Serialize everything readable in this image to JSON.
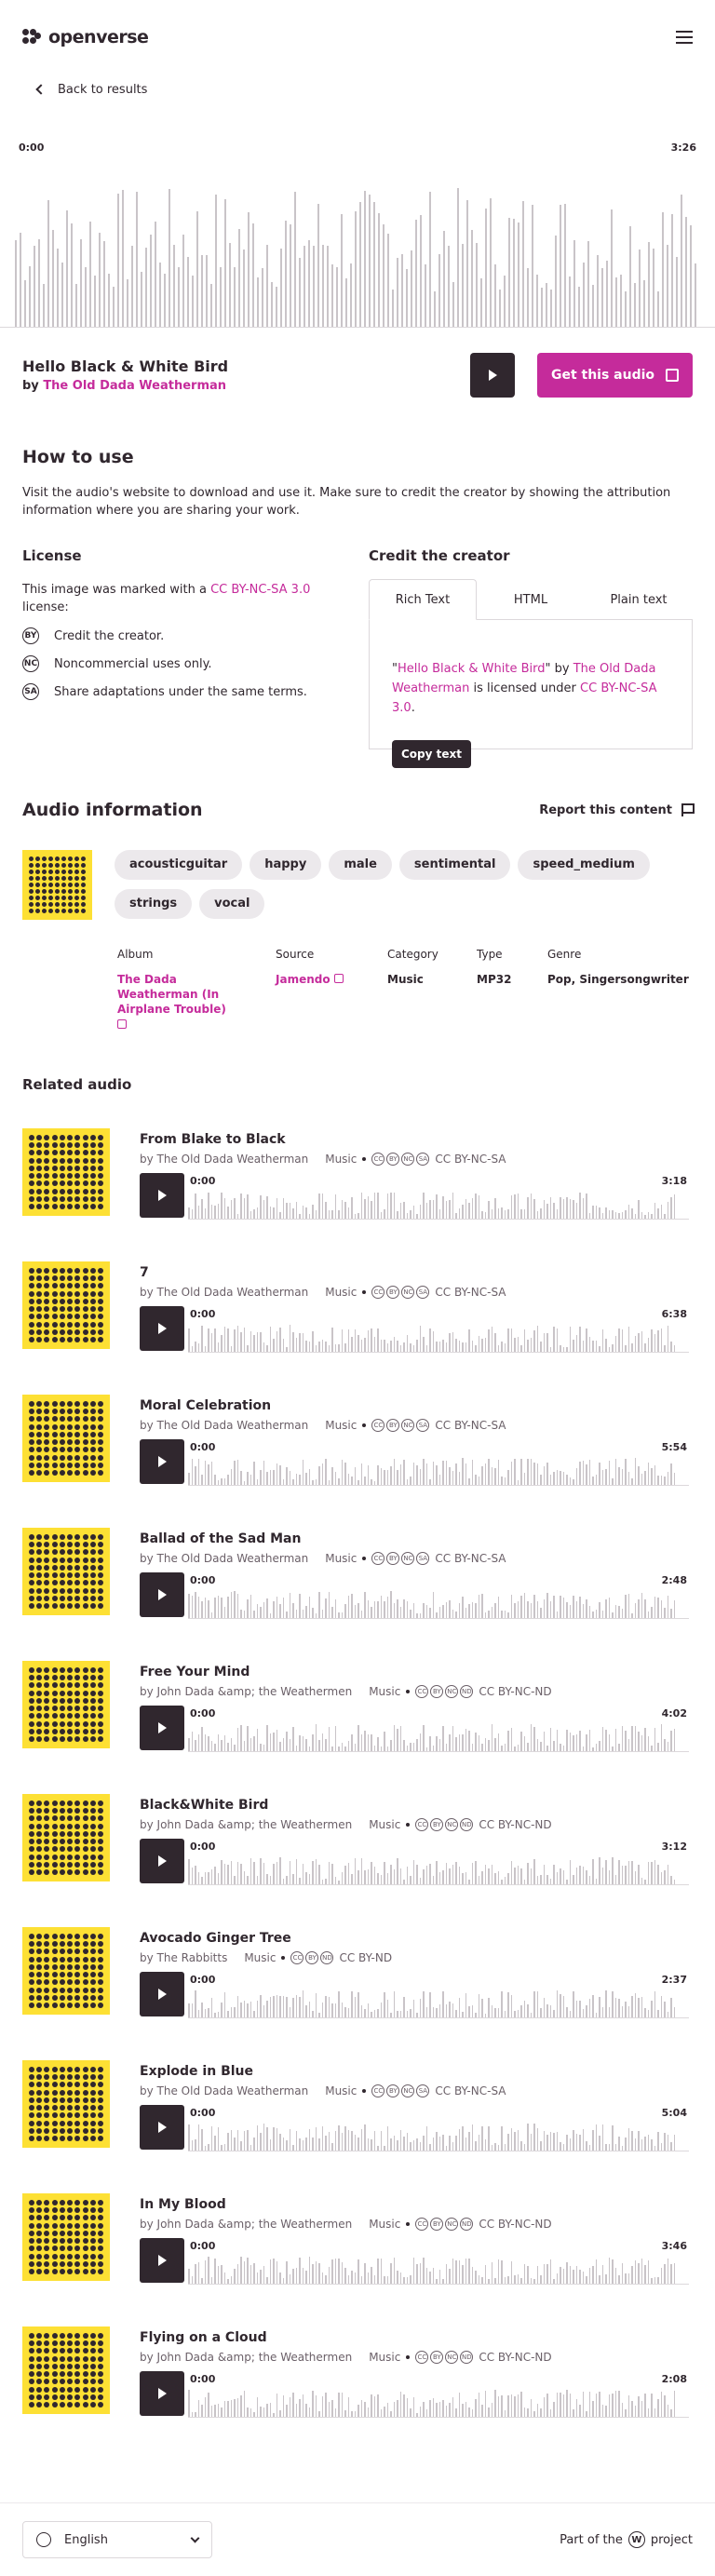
{
  "header": {
    "logo_text": "openverse"
  },
  "back_link": "Back to results",
  "player": {
    "start_time": "0:00",
    "end_time": "3:26"
  },
  "audio": {
    "title": "Hello Black & White Bird",
    "by_prefix": "by",
    "creator": "The Old Dada Weatherman",
    "get_button": "Get this audio"
  },
  "how_to_use": {
    "heading": "How to use",
    "text": "Visit the audio's website to download and use it. Make sure to credit the creator by showing the attribution information where you are sharing your work."
  },
  "license": {
    "heading": "License",
    "text_prefix": "This image was marked with a",
    "license_name": "CC BY-NC-SA 3.0",
    "text_suffix": "license:",
    "items": [
      {
        "icon": "BY",
        "text": "Credit the creator."
      },
      {
        "icon": "NC",
        "text": "Noncommercial uses only."
      },
      {
        "icon": "SA",
        "text": "Share adaptations under the same terms."
      }
    ]
  },
  "credit": {
    "heading": "Credit the creator",
    "tabs": [
      "Rich Text",
      "HTML",
      "Plain text"
    ],
    "quote_open": "\"",
    "work_title": "Hello Black & White Bird",
    "quote_by": "\" by",
    "creator": "The Old Dada Weatherman",
    "licensed_under": "is licensed under",
    "license": "CC BY-NC-SA 3.0",
    "period": ".",
    "copy_button": "Copy text"
  },
  "audio_info": {
    "heading": "Audio information",
    "report": "Report this content",
    "tags": [
      "acousticguitar",
      "happy",
      "male",
      "sentimental",
      "speed_medium",
      "strings",
      "vocal"
    ],
    "meta": {
      "album_label": "Album",
      "album_value": "The Dada Weatherman (In Airplane Trouble)",
      "source_label": "Source",
      "source_value": "Jamendo",
      "category_label": "Category",
      "category_value": "Music",
      "type_label": "Type",
      "type_value": "MP32",
      "genre_label": "Genre",
      "genre_value": "Pop, Singersongwriter"
    }
  },
  "related": {
    "heading": "Related audio",
    "items": [
      {
        "title": "From Blake to Black",
        "by": "by The Old Dada Weatherman",
        "category": "Music",
        "license": "CC BY-NC-SA",
        "start": "0:00",
        "duration": "3:18"
      },
      {
        "title": "7",
        "by": "by The Old Dada Weatherman",
        "category": "Music",
        "license": "CC BY-NC-SA",
        "start": "0:00",
        "duration": "6:38"
      },
      {
        "title": "Moral Celebration",
        "by": "by The Old Dada Weatherman",
        "category": "Music",
        "license": "CC BY-NC-SA",
        "start": "0:00",
        "duration": "5:54"
      },
      {
        "title": "Ballad of the Sad Man",
        "by": "by The Old Dada Weatherman",
        "category": "Music",
        "license": "CC BY-NC-SA",
        "start": "0:00",
        "duration": "2:48"
      },
      {
        "title": "Free Your Mind",
        "by": "by John Dada &amp; the Weathermen",
        "category": "Music",
        "license": "CC BY-NC-ND",
        "start": "0:00",
        "duration": "4:02"
      },
      {
        "title": "Black&White Bird",
        "by": "by John Dada &amp; the Weathermen",
        "category": "Music",
        "license": "CC BY-NC-ND",
        "start": "0:00",
        "duration": "3:12"
      },
      {
        "title": "Avocado Ginger Tree",
        "by": "by The Rabbitts",
        "category": "Music",
        "license": "CC BY-ND",
        "start": "0:00",
        "duration": "2:37"
      },
      {
        "title": "Explode in Blue",
        "by": "by The Old Dada Weatherman",
        "category": "Music",
        "license": "CC BY-NC-SA",
        "start": "0:00",
        "duration": "5:04"
      },
      {
        "title": "In My Blood",
        "by": "by John Dada &amp; the Weathermen",
        "category": "Music",
        "license": "CC BY-NC-ND",
        "start": "0:00",
        "duration": "3:46"
      },
      {
        "title": "Flying on a Cloud",
        "by": "by John Dada &amp; the Weathermen",
        "category": "Music",
        "license": "CC BY-NC-ND",
        "start": "0:00",
        "duration": "2:08"
      }
    ]
  },
  "footer": {
    "language": "English",
    "part_of": "Part of the",
    "project": "project"
  },
  "colors": {
    "accent": "#c52b9b",
    "dark": "#30272e",
    "thumb": "#fde034"
  }
}
